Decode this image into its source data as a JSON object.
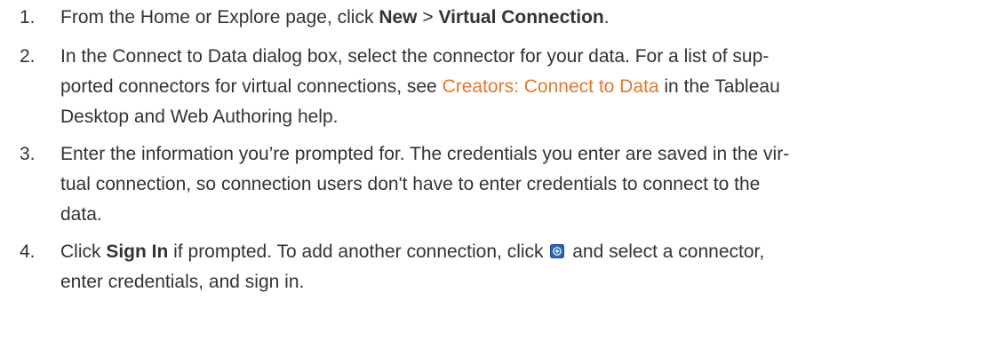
{
  "steps": [
    {
      "number": "1.",
      "t1": "From the Home or Explore page, click ",
      "b1": "New",
      "t2": " > ",
      "b2": "Virtual Connection",
      "t3": "."
    },
    {
      "number": "2.",
      "t1": "In the Connect to Data dialog box, select the connector for your data. For a list of sup-",
      "t2": "ported connectors for virtual connections, see ",
      "link": "Creators: Connect to Data",
      "t3": " in the Tableau",
      "t4": "Desktop and Web Authoring help."
    },
    {
      "number": "3.",
      "t1": "Enter the information you’re prompted for. The credentials you enter are saved in the vir-",
      "t2": "tual connection, so connection users don't have to enter credentials to connect to the",
      "t3": "data."
    },
    {
      "number": "4.",
      "t1": "Click ",
      "b1": "Sign In",
      "t2": " if prompted. To add another connection, click ",
      "icon": "add-connection-icon",
      "t3": " and select a connector,",
      "t4": "enter credentials, and sign in."
    }
  ],
  "colors": {
    "text": "#333333",
    "link": "#e8762d",
    "icon_fill": "#2b67b0"
  }
}
